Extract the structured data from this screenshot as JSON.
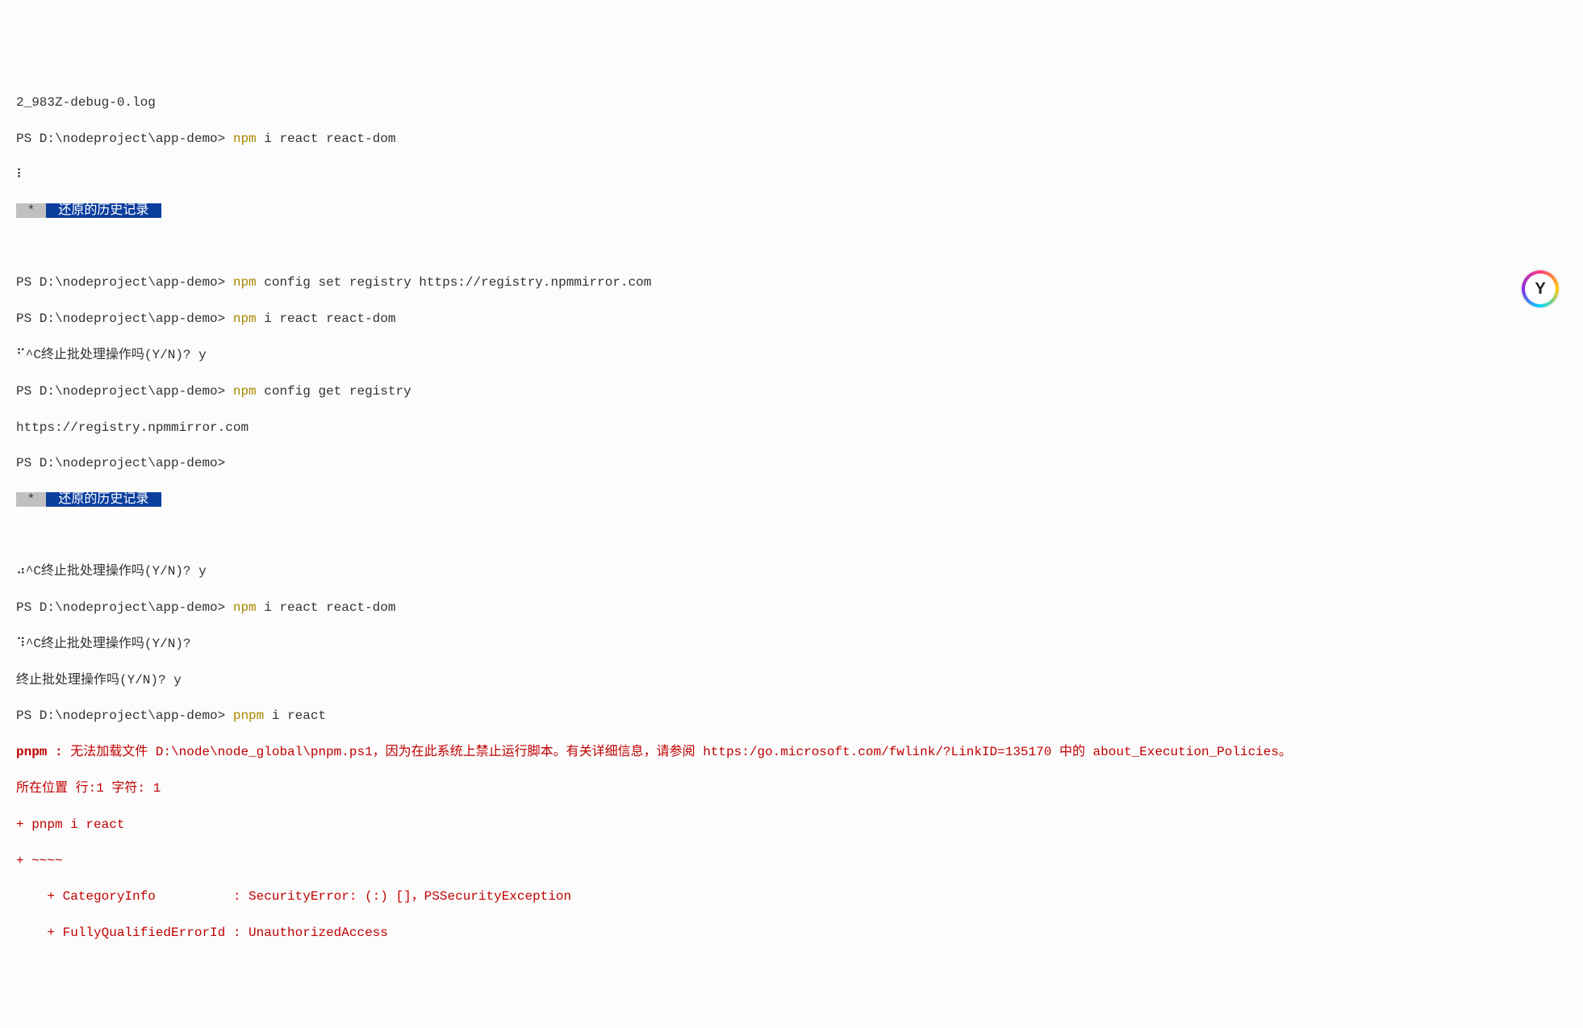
{
  "lines": {
    "l0": "2_983Z-debug-0.log",
    "l1_path": "PS D:\\nodeproject\\app-demo> ",
    "l1_cmd": "npm ",
    "l1_args": "i react react-dom",
    "l2": "⠇",
    "history_star": " * ",
    "history_text": " 还原的历史记录 ",
    "blank": "",
    "l4_path": "PS D:\\nodeproject\\app-demo> ",
    "l4_cmd": "npm ",
    "l4_args": "config set registry https://registry.npmmirror.com",
    "l5_path": "PS D:\\nodeproject\\app-demo> ",
    "l5_cmd": "npm ",
    "l5_args": "i react react-dom",
    "l6": "⠋^C终止批处理操作吗(Y/N)? y",
    "l7_path": "PS D:\\nodeproject\\app-demo> ",
    "l7_cmd": "npm ",
    "l7_args": "config get registry",
    "l8": "https://registry.npmmirror.com",
    "l9_path": "PS D:\\nodeproject\\app-demo>",
    "l11": "⠴^C终止批处理操作吗(Y/N)? y",
    "l12_path": "PS D:\\nodeproject\\app-demo> ",
    "l12_cmd": "npm ",
    "l12_args": "i react react-dom",
    "l13": "⠹^C终止批处理操作吗(Y/N)?",
    "l14": "终止批处理操作吗(Y/N)? y",
    "l15_path": "PS D:\\nodeproject\\app-demo> ",
    "l15_cmd": "pnpm ",
    "l15_args": "i react",
    "err1_a": "pnpm : ",
    "err1_b": "无法加载文件 D:\\node\\node_global\\pnpm.ps1，因为在此系统上禁止运行脚本。有关详细信息，请参阅 https:/go.microsoft.com/fwlink/?LinkID=135170 中的 about_Execution_Policies。",
    "err2": "所在位置 行:1 字符: 1",
    "err3": "+ pnpm i react",
    "err4": "+ ~~~~",
    "err5": "    + CategoryInfo          : SecurityError: (:) []，PSSecurityException",
    "err6": "    + FullyQualifiedErrorId : UnauthorizedAccess"
  },
  "logo_glyph": "Y",
  "colors": {
    "cmd": "#aa8800",
    "error": "#c00000",
    "history_bg": "#0c3e9e"
  }
}
